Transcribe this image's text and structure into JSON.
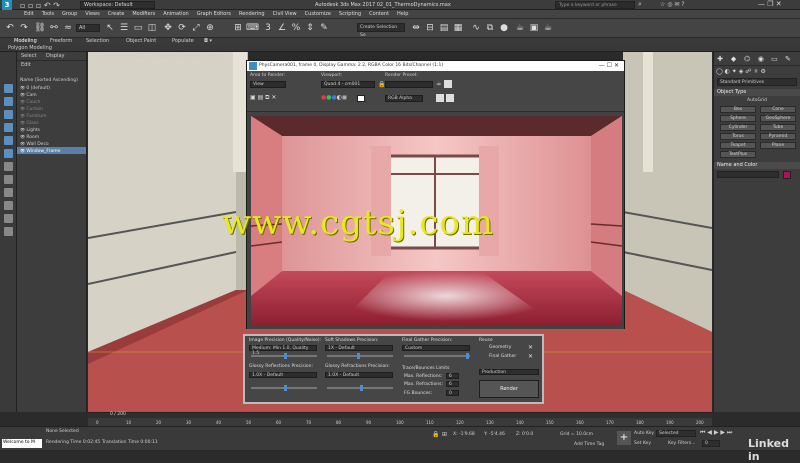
{
  "app": {
    "logo": "3",
    "workspace_label": "Workspace: Default",
    "title": "Autodesk 3ds Max 2017      02_01_ThermoDynamics.max",
    "search_placeholder": "Type a keyword or phrase"
  },
  "menus": [
    "Edit",
    "Tools",
    "Group",
    "Views",
    "Create",
    "Modifiers",
    "Animation",
    "Graph Editors",
    "Rendering",
    "Civil View",
    "Customize",
    "Scripting",
    "Content",
    "Help"
  ],
  "toolbar": {
    "filter_value": "All",
    "selection_set": "Create Selection Se"
  },
  "ribbon": {
    "tabs": [
      "Modeling",
      "Freeform",
      "Selection",
      "Object Paint",
      "Populate"
    ],
    "sub": "Polygon Modeling"
  },
  "scene_explorer": {
    "tabs": [
      "Select",
      "Display",
      "Edit"
    ],
    "header": "Name (Sorted Ascending)",
    "rows": [
      {
        "name": "0 (default)",
        "dim": false,
        "hl": false
      },
      {
        "name": "Cam",
        "dim": false,
        "hl": false
      },
      {
        "name": "Couch",
        "dim": true,
        "hl": false
      },
      {
        "name": "Curtain",
        "dim": true,
        "hl": false
      },
      {
        "name": "Furniture",
        "dim": true,
        "hl": false
      },
      {
        "name": "Glass",
        "dim": true,
        "hl": false
      },
      {
        "name": "Lights",
        "dim": false,
        "hl": false
      },
      {
        "name": "Room",
        "dim": false,
        "hl": false
      },
      {
        "name": "Wall Deco",
        "dim": false,
        "hl": false
      },
      {
        "name": "Window_Frame",
        "dim": false,
        "hl": true
      }
    ]
  },
  "viewport": {
    "label": "[+] [PhysCamera001 ] [Standard ] [Default Shading ]"
  },
  "frame_buffer": {
    "title": "PhysCamera001, frame 0, Display Gamma: 2.2, RGBA Color 16 Bits/Channel (1:1)",
    "area_label": "Area to Render:",
    "area_value": "View",
    "viewport_label": "Viewport:",
    "viewport_value": "Quad 4 - cm001",
    "preset_label": "Render Preset:",
    "channel_value": "RGB Alpha"
  },
  "render_setup": {
    "image_precision_label": "Image Precision (Quality/Noise):",
    "image_precision_value": "Medium: Min 1.0, Quality 1.5",
    "soft_shadows_label": "Soft Shadows Precision:",
    "soft_shadows_value": "1X - Default",
    "final_gather_label": "Final Gather Precision:",
    "final_gather_value": "Custom",
    "glossy_refl_label": "Glossy Reflections Precision:",
    "glossy_refl_value": "1.0X - Default",
    "glossy_refr_label": "Glossy Refractions Precision:",
    "glossy_refr_value": "1.0X - Default",
    "trace_label": "Trace/Bounces Limits",
    "max_reflections_label": "Max. Reflections:",
    "max_reflections_value": "6",
    "max_refractions_label": "Max. Refractions:",
    "max_refractions_value": "6",
    "fg_bounces_label": "FG Bounces:",
    "fg_bounces_value": "0",
    "reuse_label": "Reuse",
    "geometry_label": "Geometry",
    "final_gather_reuse_label": "Final Gather",
    "mode_value": "Production",
    "render_button": "Render"
  },
  "command_panel": {
    "dropdown": "Standard Primitives",
    "object_type_header": "Object Type",
    "autogrid": "AutoGrid",
    "buttons": [
      "Box",
      "Cone",
      "Sphere",
      "GeoSphere",
      "Cylinder",
      "Tube",
      "Torus",
      "Pyramid",
      "Teapot",
      "Plane",
      "TextPlus"
    ],
    "name_color_header": "Name and Color",
    "color_swatch": "#b0125a"
  },
  "timeline": {
    "frame": "0 / 200",
    "ticks": [
      "0",
      "10",
      "20",
      "30",
      "40",
      "50",
      "60",
      "70",
      "80",
      "90",
      "100",
      "110",
      "120",
      "130",
      "140",
      "150",
      "160",
      "170",
      "180",
      "190",
      "200"
    ]
  },
  "status": {
    "maxscript": "Welcome to M",
    "none_selected": "None Selected",
    "rendering_time": "Rendering Time  0:02:45",
    "translation_time": "Translation Time  0:00:11",
    "x": "X: -1'9.68",
    "y": "Y: -5'4.46",
    "z": "Z: 0'0.0",
    "grid": "Grid = 10.0cm",
    "add_time_tag": "Add Time Tag",
    "auto_key": "Auto Key",
    "selected": "Selected",
    "set_key": "Set Key",
    "key_filters": "Key Filters...",
    "frame_num": "0"
  },
  "watermark": "www.cgtsj.com",
  "brand": "Linked in"
}
